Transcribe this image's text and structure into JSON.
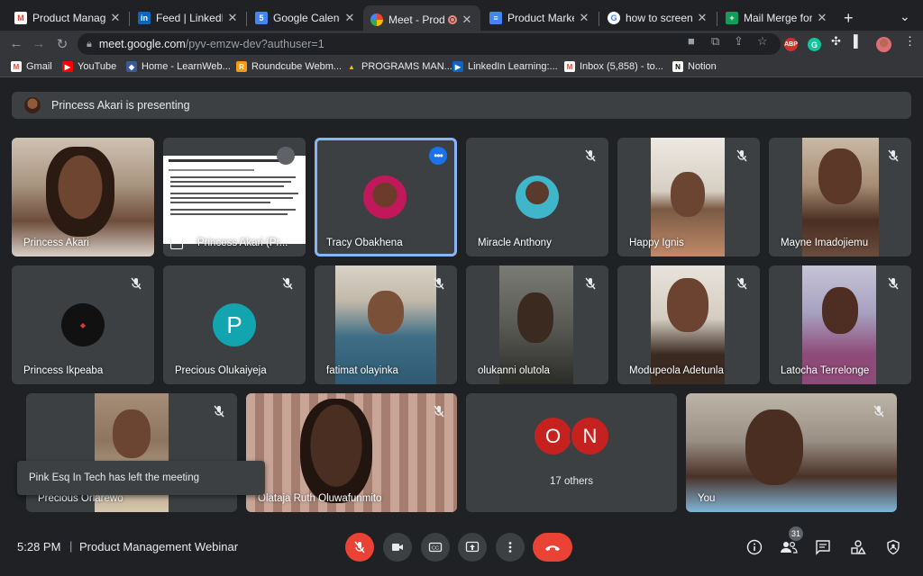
{
  "browser": {
    "tabs": [
      {
        "title": "Product Managem",
        "icon": "gmail-icon",
        "color": "#ea4335",
        "letter": "M"
      },
      {
        "title": "Feed | LinkedIn",
        "icon": "linkedin-icon",
        "color": "#0a66c2",
        "letter": "in"
      },
      {
        "title": "Google Calendar",
        "icon": "calendar-icon",
        "color": "#4285f4",
        "letter": "5"
      },
      {
        "title": "Meet - Produ",
        "icon": "meet-icon",
        "color": "#00ac47",
        "letter": "M"
      },
      {
        "title": "Product Marketing",
        "icon": "docs-icon",
        "color": "#4285f4",
        "letter": "≡"
      },
      {
        "title": "how to screensho",
        "icon": "google-icon",
        "color": "#ffffff",
        "letter": "G"
      },
      {
        "title": "Mail Merge for NT",
        "icon": "sheets-icon",
        "color": "#0f9d58",
        "letter": "+"
      }
    ],
    "url_host": "meet.google.com",
    "url_path": "/pyv-emzw-dev?authuser=1",
    "extensions": [
      {
        "icon": "adblock-icon",
        "label": "ABP",
        "color": "#d0312d"
      },
      {
        "icon": "grammarly-icon",
        "label": "G",
        "color": "#15c39a"
      }
    ],
    "bookmarks": [
      {
        "label": "Gmail",
        "icon": "gmail-icon",
        "color": "#ea4335",
        "letter": "M"
      },
      {
        "label": "YouTube",
        "icon": "youtube-icon",
        "color": "#ff0000",
        "letter": "▶"
      },
      {
        "label": "Home - LearnWeb...",
        "icon": "learnweb-icon",
        "color": "#3b5998",
        "letter": "◆"
      },
      {
        "label": "Roundcube Webm...",
        "icon": "roundcube-icon",
        "color": "#f39c12",
        "letter": "R"
      },
      {
        "label": "PROGRAMS MAN...",
        "icon": "drive-icon",
        "color": "#fbbc04",
        "letter": "▲"
      },
      {
        "label": "LinkedIn Learning:...",
        "icon": "linkedin-learning-icon",
        "color": "#0a66c2",
        "letter": "▶"
      },
      {
        "label": "Inbox (5,858) - to...",
        "icon": "gmail-icon",
        "color": "#ea4335",
        "letter": "M"
      },
      {
        "label": "Notion",
        "icon": "notion-icon",
        "color": "#ffffff",
        "letter": "N"
      }
    ]
  },
  "meet": {
    "presenting_text": "Princess Akari is presenting",
    "participants": [
      {
        "name": "Princess Akari",
        "kind": "video"
      },
      {
        "name": "Princess Akari (Pr...",
        "kind": "screen"
      },
      {
        "name": "Tracy Obakhena",
        "kind": "avatar"
      },
      {
        "name": "Miracle Anthony",
        "kind": "avatar"
      },
      {
        "name": "Happy Ignis",
        "kind": "video"
      },
      {
        "name": "Mayne Imadojiemu",
        "kind": "video"
      },
      {
        "name": "Princess Ikpeaba",
        "kind": "avatar"
      },
      {
        "name": "Precious Olukaiyeja",
        "kind": "letter",
        "letter": "P",
        "color": "#12a4af"
      },
      {
        "name": "fatimat olayinka",
        "kind": "video"
      },
      {
        "name": "olukanni olutola",
        "kind": "video"
      },
      {
        "name": "Modupeola Adetunla",
        "kind": "video"
      },
      {
        "name": "Latocha Terrelonge",
        "kind": "video"
      },
      {
        "name": "Precious Orlarewo",
        "kind": "video"
      },
      {
        "name": "Olataja Ruth Oluwafunmito",
        "kind": "video"
      },
      {
        "name": "You",
        "kind": "video"
      }
    ],
    "others": {
      "letters": [
        "O",
        "N"
      ],
      "label": "17 others",
      "color": "#c5221f"
    },
    "toast": "Pink Esq In Tech has left the meeting",
    "bottom": {
      "time": "5:28 PM",
      "separator": "|",
      "meeting_name": "Product Management Webinar",
      "participant_count": "31"
    },
    "colors": {
      "accent": "#8ab4f8",
      "danger": "#ea4335",
      "tile": "#3c4043",
      "bg": "#202124"
    }
  }
}
